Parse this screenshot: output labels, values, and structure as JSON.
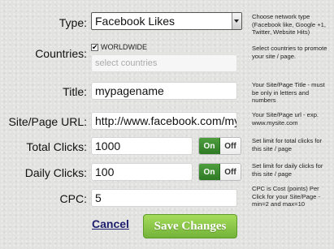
{
  "type": {
    "label": "Type:",
    "value": "Facebook Likes",
    "hint": "Choose network type (Facebook like, Google +1, Twitter, Website Hits)"
  },
  "countries": {
    "label": "Countries:",
    "worldwide_label": "WORLDWIDE",
    "worldwide_checked": true,
    "select_placeholder": "select countries",
    "hint": "Select countries to promote your site / page."
  },
  "title": {
    "label": "Title:",
    "value": "mypagename",
    "hint": "Your Site/Page Title - must be only in letters and numbers"
  },
  "url": {
    "label": "Site/Page URL:",
    "value": "http://www.facebook.com/mypagename",
    "hint": "Your Site/Page url - exp. www.mysite.com"
  },
  "total_clicks": {
    "label": "Total Clicks:",
    "value": "1000",
    "on_label": "On",
    "off_label": "Off",
    "state": "on",
    "hint": "Set limit for total clicks for this site / page"
  },
  "daily_clicks": {
    "label": "Daily Clicks:",
    "value": "100",
    "on_label": "On",
    "off_label": "Off",
    "state": "on",
    "hint": "Set limit for daily clicks for this site / page"
  },
  "cpc": {
    "label": "CPC:",
    "value": "5",
    "hint": "CPC is Cost (points) Per Click for your Site/Page - min=2 and max=10"
  },
  "actions": {
    "cancel_label": "Cancel",
    "save_label": "Save Changes"
  },
  "colors": {
    "toggle_on": "#3a8a2e",
    "save_button": "#8cc84b",
    "cancel_link": "#1e1e6e"
  }
}
